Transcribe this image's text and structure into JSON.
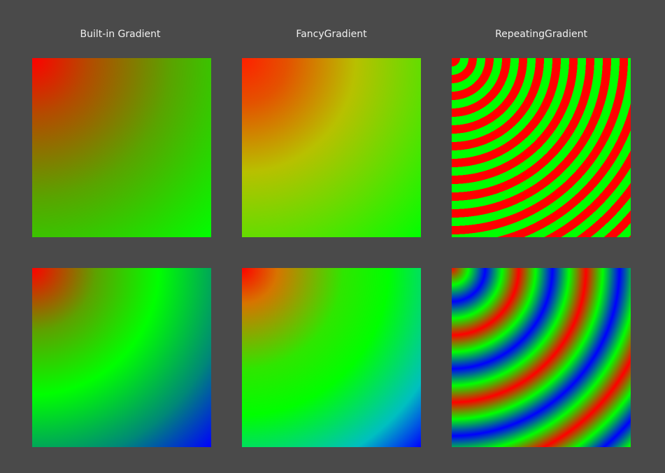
{
  "columns": [
    {
      "label": "Built-in Gradient"
    },
    {
      "label": "FancyGradient"
    },
    {
      "label": "RepeatingGradient"
    }
  ],
  "colors": {
    "background": "#4a4a4a",
    "label_text": "#f0f0f0",
    "red": "#ff0000",
    "green": "#00ff00",
    "blue": "#0000ff"
  }
}
